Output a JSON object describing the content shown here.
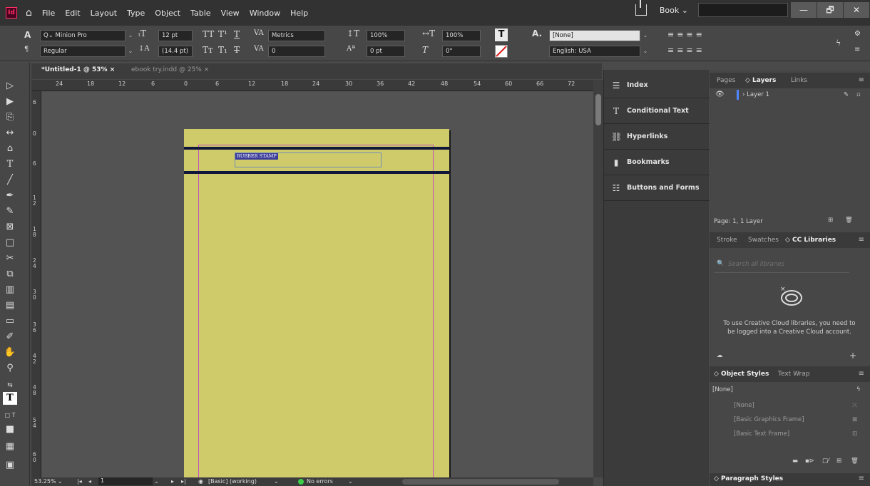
{
  "app": {
    "logo": "Id",
    "home_icon": "home-icon"
  },
  "menu": [
    "File",
    "Edit",
    "Layout",
    "Type",
    "Object",
    "Table",
    "View",
    "Window",
    "Help"
  ],
  "workspace": "Book",
  "window_buttons": [
    "—",
    "🗗",
    "✕"
  ],
  "control_panel": {
    "font_family": "Minion Pro",
    "font_style": "Regular",
    "font_size": "12 pt",
    "leading": "(14.4 pt)",
    "kerning": "Metrics",
    "tracking": "0",
    "vscale": "100%",
    "hscale": "100%",
    "baseline": "0 pt",
    "skew": "0°",
    "char_style": "[None]",
    "language": "English: USA"
  },
  "tabs": [
    {
      "label": "*Untitled-1 @ 53%",
      "close": "×"
    },
    {
      "label": "ebook try.indd @ 25%",
      "close": "×"
    }
  ],
  "ruler_h": [
    "24",
    "18",
    "12",
    "6",
    "0",
    "6",
    "12",
    "18",
    "24",
    "30",
    "36",
    "42",
    "48",
    "54",
    "60",
    "66",
    "72"
  ],
  "ruler_v": [
    "6",
    "0",
    "6",
    "12",
    "18",
    "24",
    "30",
    "36",
    "42",
    "48",
    "54",
    "60"
  ],
  "document": {
    "stamp_text": "RUBBER STAMP"
  },
  "status": {
    "zoom": "53.25%",
    "page": "1",
    "profile": "[Basic] (working)",
    "preflight": "No errors"
  },
  "mid_panel": [
    {
      "label": "Index",
      "icon": "index-icon"
    },
    {
      "label": "Conditional Text",
      "icon": "conditional-text-icon"
    },
    {
      "label": "Hyperlinks",
      "icon": "hyperlinks-icon"
    },
    {
      "label": "Bookmarks",
      "icon": "bookmark-icon"
    },
    {
      "label": "Buttons and Forms",
      "icon": "buttons-forms-icon"
    }
  ],
  "layers_panel": {
    "tabs": [
      "Pages",
      "◇ Layers",
      "Links"
    ],
    "layer_name": "Layer 1",
    "footer": "Page: 1, 1 Layer"
  },
  "libraries_panel": {
    "tabs": [
      "Stroke",
      "Swatches",
      "◇ CC Libraries"
    ],
    "search_placeholder": "Search all libraries",
    "message": "To use Creative Cloud libraries, you need to be logged into a Creative Cloud account."
  },
  "object_styles_panel": {
    "tabs": [
      "◇ Object Styles",
      "Text Wrap"
    ],
    "current": "[None]",
    "items": [
      "[None]",
      "[Basic Graphics Frame]",
      "[Basic Text Frame]"
    ]
  },
  "paragraph_styles_panel": {
    "tab": "◇ Paragraph Styles"
  },
  "colors": {
    "accent": "#ff3366",
    "page": "#cfcb6a",
    "margin": "#c34fbf",
    "frame": "#6f8db7"
  }
}
